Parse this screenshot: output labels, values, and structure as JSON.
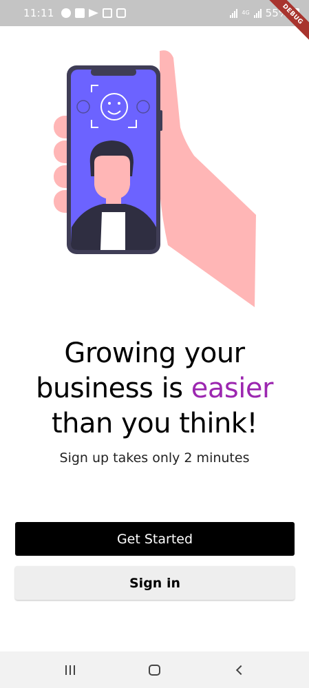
{
  "status_bar": {
    "time": "11:11",
    "network": "4G",
    "battery": "55%"
  },
  "debug_banner": "DEBUG",
  "headline": {
    "line1": "Growing your",
    "line2_start": "business is ",
    "line2_accent": "easier",
    "line3": "than you think!"
  },
  "subtitle": "Sign up takes only 2 minutes",
  "buttons": {
    "primary": "Get Started",
    "secondary": "Sign in"
  },
  "colors": {
    "accent": "#9c27b0",
    "primary_button": "#000000",
    "secondary_button": "#eeeeee",
    "phone_screen": "#6c63ff",
    "hand": "#ffb6b6"
  },
  "icons": [
    "recents-icon",
    "home-icon",
    "back-icon"
  ]
}
